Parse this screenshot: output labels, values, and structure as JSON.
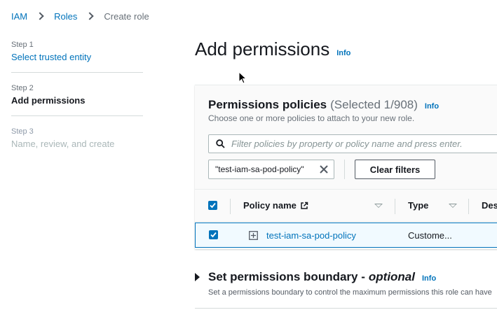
{
  "breadcrumb": {
    "items": [
      "IAM",
      "Roles"
    ],
    "current": "Create role"
  },
  "steps": [
    {
      "num": "Step 1",
      "title": "Select trusted entity",
      "state": "link"
    },
    {
      "num": "Step 2",
      "title": "Add permissions",
      "state": "active"
    },
    {
      "num": "Step 3",
      "title": "Name, review, and create",
      "state": "disabled"
    }
  ],
  "page": {
    "title": "Add permissions",
    "info": "Info"
  },
  "policies": {
    "title": "Permissions policies",
    "count": "(Selected 1/908)",
    "info": "Info",
    "description": "Choose one or more policies to attach to your new role.",
    "search_placeholder": "Filter policies by property or policy name and press enter.",
    "filter_token": "\"test-iam-sa-pod-policy\"",
    "clear_filters": "Clear filters",
    "columns": [
      "Policy name",
      "Type",
      "Des"
    ],
    "rows": [
      {
        "selected": true,
        "name": "test-iam-sa-pod-policy",
        "type": "Custome..."
      }
    ]
  },
  "boundary": {
    "title": "Set permissions boundary -",
    "optional": "optional",
    "info": "Info",
    "description": "Set a permissions boundary to control the maximum permissions this role can have"
  },
  "colors": {
    "link": "#0073bb",
    "selected_row_bg": "#f1faff",
    "text": "#16191f",
    "muted": "#687078"
  },
  "icons": [
    "chevron-right-icon",
    "search-icon",
    "close-icon",
    "checkbox-icon",
    "external-link-icon",
    "sort-icon",
    "expand-icon",
    "caret-right-icon",
    "cursor-icon"
  ]
}
